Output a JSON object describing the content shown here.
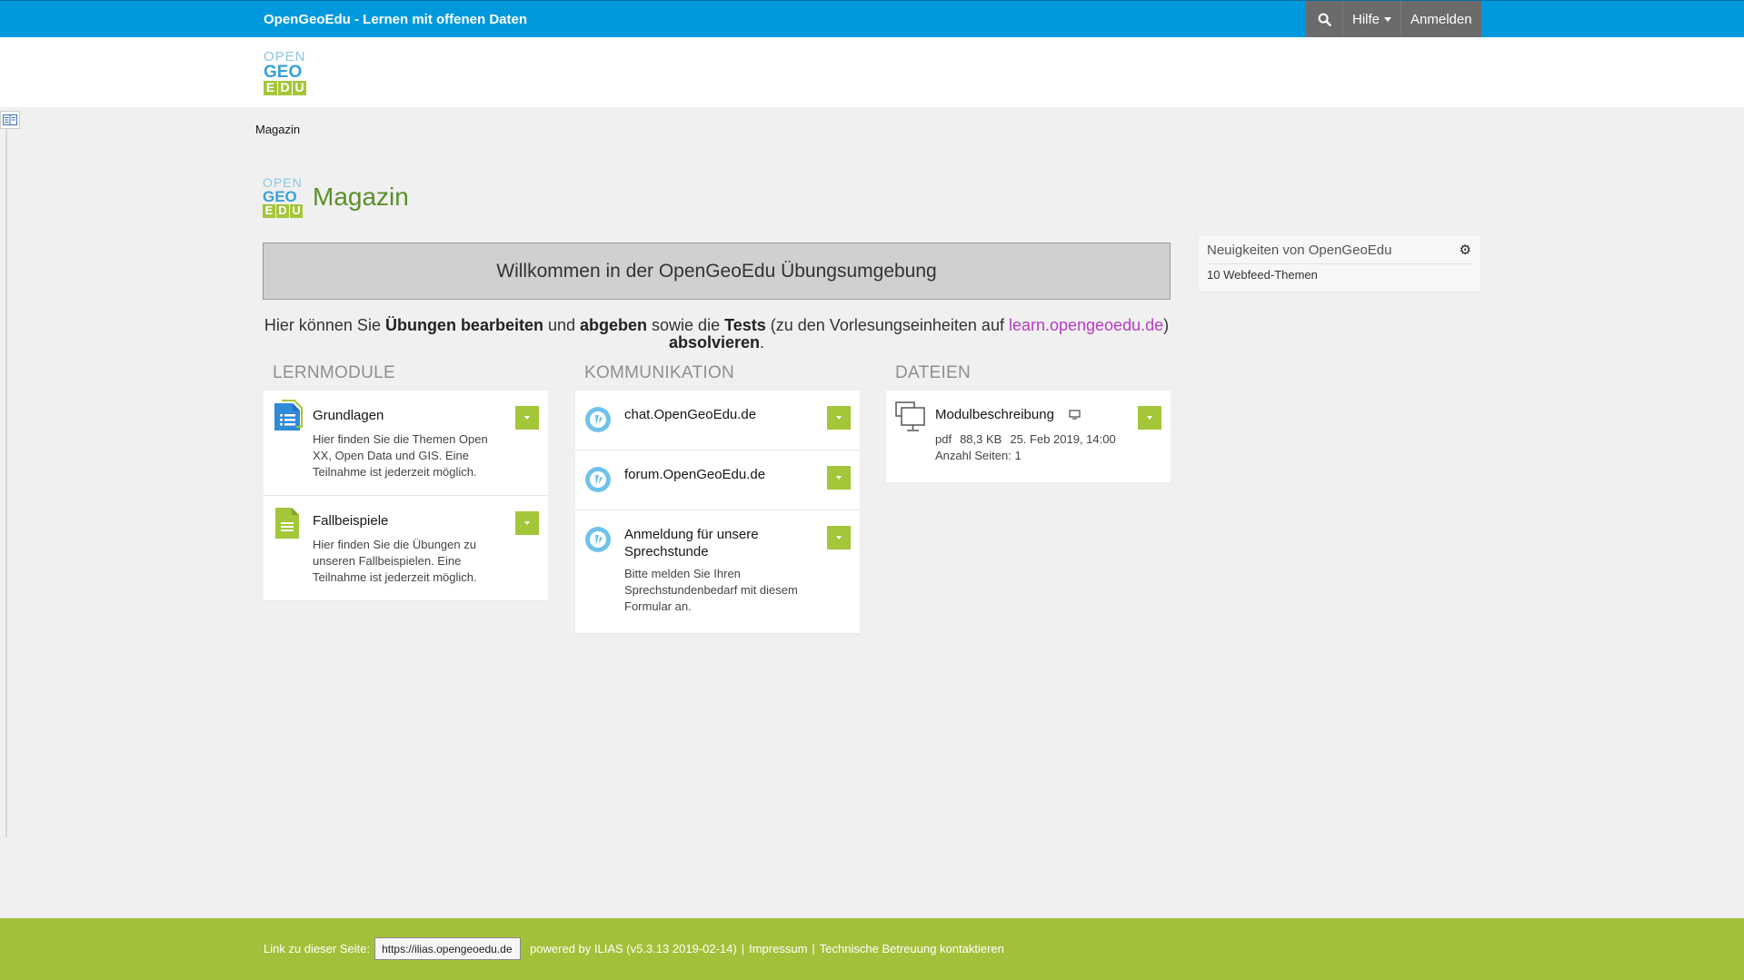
{
  "topbar": {
    "title": "OpenGeoEdu - Lernen mit offenen Daten",
    "help_label": "Hilfe",
    "login_label": "Anmelden"
  },
  "logo": {
    "line1": "OPEN",
    "line2": "GEO",
    "line3": [
      "E",
      "D",
      "U"
    ]
  },
  "breadcrumb": "Magazin",
  "page_title": "Magazin",
  "welcome": "Willkommen in der OpenGeoEdu Übungsumgebung",
  "intro": {
    "t1": "Hier können Sie ",
    "b1": "Übungen bearbeiten",
    "t2": " und ",
    "b2": "abgeben",
    "t3": " sowie die ",
    "b3": "Tests",
    "t4": " (zu den Vorlesungseinheiten auf ",
    "link": "learn.opengeoedu.de",
    "t5": ") ",
    "b4": "absolvieren",
    "t6": "."
  },
  "columns": {
    "lernmodule": {
      "heading": "LERNMODULE",
      "items": [
        {
          "title": "Grundlagen",
          "desc": "Hier finden Sie die Themen Open XX, Open Data und GIS. Eine Teilnahme ist jederzeit möglich."
        },
        {
          "title": "Fallbeispiele",
          "desc": "Hier finden Sie die Übungen zu unseren Fallbeispielen. Eine Teilnahme ist jederzeit möglich."
        }
      ]
    },
    "kommunikation": {
      "heading": "KOMMUNIKATION",
      "items": [
        {
          "title": "chat.OpenGeoEdu.de"
        },
        {
          "title": "forum.OpenGeoEdu.de"
        },
        {
          "title": "Anmeldung für unsere Sprechstunde",
          "desc": "Bitte melden Sie Ihren Sprechstundenbedarf mit diesem Formular an."
        }
      ]
    },
    "dateien": {
      "heading": "DATEIEN",
      "items": [
        {
          "title": "Modulbeschreibung",
          "type": "pdf",
          "size": "88,3 KB",
          "date": "25. Feb 2019, 14:00",
          "pages": "Anzahl Seiten: 1"
        }
      ]
    }
  },
  "news": {
    "heading": "Neuigkeiten von OpenGeoEdu",
    "item": "10 Webfeed-Themen"
  },
  "footer": {
    "link_label": "Link zu dieser Seite:",
    "link_value": "https://ilias.opengeoedu.de",
    "powered": "powered by ILIAS (v5.3.13 2019-02-14)",
    "impressum": "Impressum",
    "support": "Technische Betreuung kontaktieren"
  },
  "colors": {
    "topbar": "#0099dd",
    "accent_green": "#a4c639",
    "title_green": "#5b8f2a",
    "link_purple": "#b83bc4"
  }
}
